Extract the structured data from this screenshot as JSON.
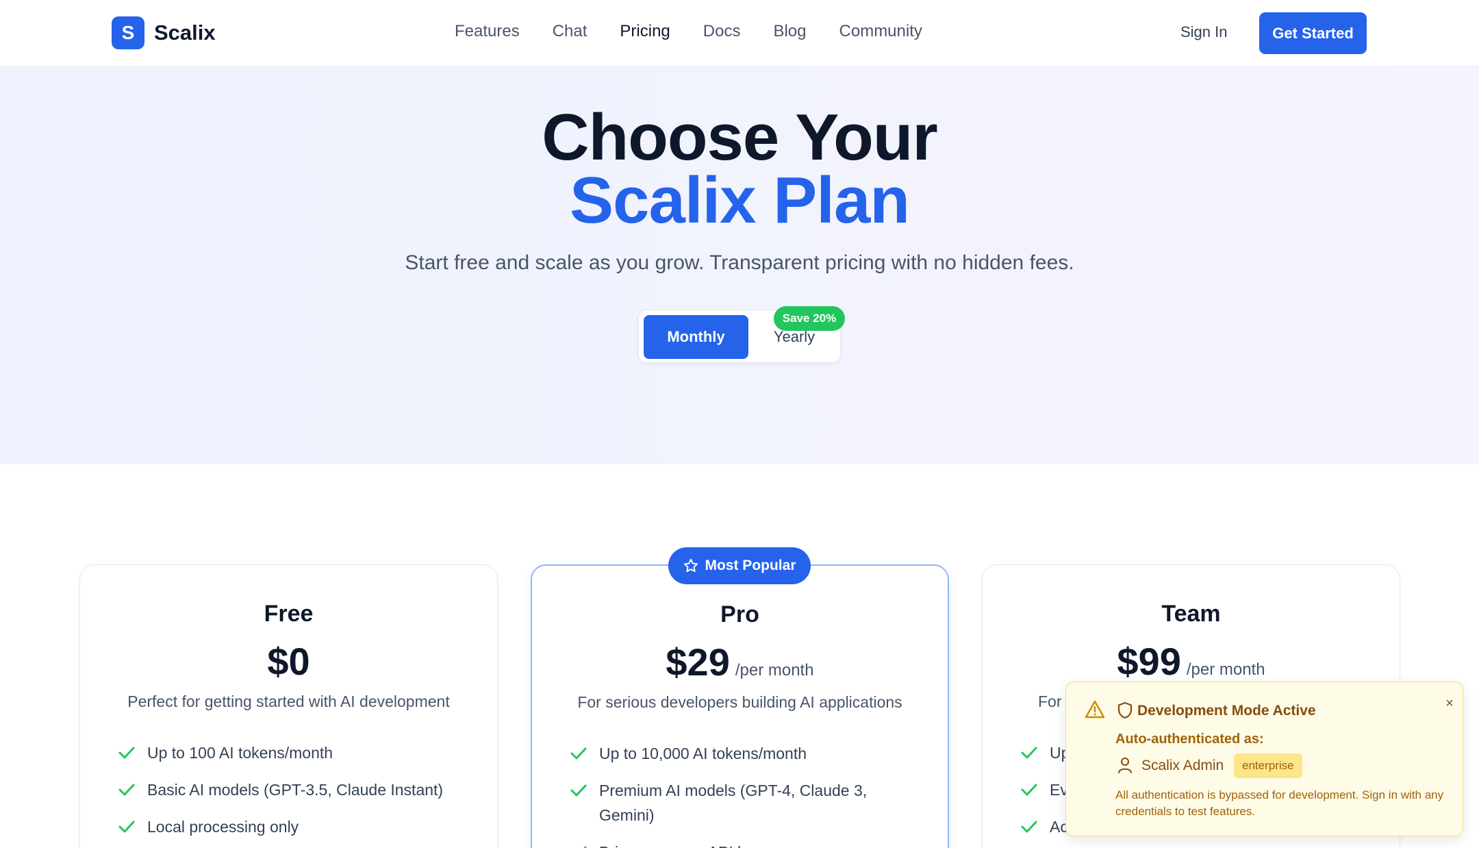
{
  "brand": {
    "logo_letter": "S",
    "name": "Scalix"
  },
  "nav": {
    "links": [
      "Features",
      "Chat",
      "Pricing",
      "Docs",
      "Blog",
      "Community"
    ],
    "active": "Pricing",
    "sign_in": "Sign In",
    "cta": "Get Started"
  },
  "hero": {
    "title_line1": "Choose Your",
    "title_line2": "Scalix Plan",
    "subtitle": "Start free and scale as you grow. Transparent pricing with no hidden fees.",
    "billing": {
      "monthly": "Monthly",
      "yearly": "Yearly",
      "selected": "Monthly",
      "yearly_badge": "Save 20%"
    }
  },
  "plans": [
    {
      "name": "Free",
      "price": "$0",
      "period": "",
      "description": "Perfect for getting started with AI development",
      "features": [
        "Up to 100 AI tokens/month",
        "Basic AI models (GPT-3.5, Claude Instant)",
        "Local processing only"
      ]
    },
    {
      "name": "Pro",
      "price": "$29",
      "period": "/per month",
      "description": "For serious developers building AI applications",
      "badge": "Most Popular",
      "features": [
        "Up to 10,000 AI tokens/month",
        "Premium AI models (GPT-4, Claude 3, Gemini)",
        "Bring your own API keys"
      ]
    },
    {
      "name": "Team",
      "price": "$99",
      "period": "/per month",
      "description": "For",
      "features": [
        "Up",
        "Ev",
        "Ac"
      ]
    }
  ],
  "dev_toast": {
    "title": "Development Mode Active",
    "label": "Auto-authenticated as:",
    "user": "Scalix Admin",
    "tier": "enterprise",
    "body": "All authentication is bypassed for development. Sign in with any credentials to test features.",
    "close": "×"
  },
  "colors": {
    "primary": "#2563eb",
    "success": "#22c55e",
    "warning": "#a16207"
  }
}
